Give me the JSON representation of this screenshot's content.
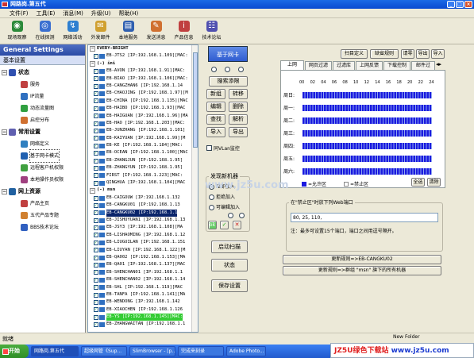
{
  "window": {
    "title": "网路岗.第五代",
    "min": "_",
    "max": "□",
    "close": "×"
  },
  "menu": [
    "文件(F)",
    "工具(E)",
    "消息(M)",
    "升级(U)",
    "帮助(H)"
  ],
  "toolbar": [
    {
      "label": "现场观察",
      "color": "#2c8a3a",
      "icon": "eye-icon",
      "glyph": "◉"
    },
    {
      "label": "在线探测",
      "color": "#3a6fd0",
      "icon": "globe-icon",
      "glyph": "◎"
    },
    {
      "label": "网络活动",
      "color": "#2e7fd0",
      "icon": "network-icon",
      "glyph": "↯"
    },
    {
      "label": "外发邮件",
      "color": "#d0a030",
      "icon": "mail-icon",
      "glyph": "✉"
    },
    {
      "label": "本地服务",
      "color": "#3060b0",
      "icon": "server-icon",
      "glyph": "▤"
    },
    {
      "label": "发送消息",
      "color": "#d07030",
      "icon": "message-icon",
      "glyph": "✎"
    },
    {
      "label": "产品信息",
      "color": "#c04040",
      "icon": "info-icon",
      "glyph": "i"
    },
    {
      "label": "技术论坛",
      "color": "#5050b0",
      "icon": "forum-icon",
      "glyph": "☷"
    }
  ],
  "left": {
    "header": "General Settings",
    "subheader": "基本设置",
    "tree": [
      {
        "label": "状态",
        "level": 0,
        "color": "#3050b0",
        "icon": "status-icon"
      },
      {
        "label": "服务",
        "level": 1,
        "color": "#c04040",
        "icon": "service-icon"
      },
      {
        "label": "IP流量",
        "level": 1,
        "color": "#3070c0",
        "icon": "ip-traffic-icon"
      },
      {
        "label": "动态流量图",
        "level": 1,
        "color": "#30a040",
        "icon": "traffic-chart-icon"
      },
      {
        "label": "启控分布",
        "level": 1,
        "color": "#d07030",
        "icon": "distribution-icon"
      },
      {
        "label": "常用设置",
        "level": 0,
        "color": "#6060b0",
        "icon": "settings-icon"
      },
      {
        "label": "网络定义",
        "level": 1,
        "color": "#3080c0",
        "icon": "network-def-icon"
      },
      {
        "label": "基于网卡模式",
        "level": 1,
        "color": "#2060b0",
        "icon": "nic-mode-icon",
        "selected": true
      },
      {
        "label": "远程客户机权限",
        "level": 1,
        "color": "#40a040",
        "icon": "remote-icon"
      },
      {
        "label": "本地操作员权限",
        "level": 1,
        "color": "#a04080",
        "icon": "operator-icon"
      },
      {
        "label": "网上资源",
        "level": 0,
        "color": "#2060a0",
        "icon": "web-resources-icon"
      },
      {
        "label": "产品主页",
        "level": 1,
        "color": "#c04040",
        "icon": "home-icon"
      },
      {
        "label": "五代产品专题",
        "level": 1,
        "color": "#d08030",
        "icon": "topic-icon"
      },
      {
        "label": "BBS技术论坛",
        "level": 1,
        "color": "#3060c0",
        "icon": "bbs-icon"
      }
    ]
  },
  "machines": [
    {
      "kind": "grp",
      "text": "EVERY-BRIGHT"
    },
    {
      "text": "EB-JTS2 [IP:192.168.1.109][MAC:"
    },
    {
      "kind": "grp",
      "text": "(-) ini"
    },
    {
      "text": "EB-AVON [IP:192.168.1.91][MAC:"
    },
    {
      "text": "EB-BIAO [IP:192.168.1.106][MAC:"
    },
    {
      "text": "EB-CANGZHAN6 [IP:192.168.1.14"
    },
    {
      "text": "EB-CHAOJING [IP:192.168.1.97][M"
    },
    {
      "text": "EB-CHINA [IP:192.168.1.135][MAC"
    },
    {
      "text": "EB-HAIBO [IP:192.168.1.93][MAC"
    },
    {
      "text": "EB-HAIGUAN [IP:192.168.1.96][MA"
    },
    {
      "text": "EB-HAO [IP:192.168.1.203][MAC:"
    },
    {
      "text": "EB-JUNZHANG [IP:192.168.1.101]"
    },
    {
      "text": "EB-KAIYUAN [IP:192.168.1.99][M"
    },
    {
      "text": "EB-KE [IP:192.168.1.184][MAC:"
    },
    {
      "text": "EB-OCEAN [IP:192.168.1.100][MAC"
    },
    {
      "text": "EB-ZHANGJUN [IP:192.168.1.95]"
    },
    {
      "text": "EB-ZHANGYUN [IP:192.168.1.95]"
    },
    {
      "text": "FIRST [IP:192.168.1.223][MAC:"
    },
    {
      "text": "QINGHUA [IP:192.168.1.104][MAC"
    },
    {
      "kind": "grp",
      "text": "(-) msn"
    },
    {
      "text": "EB-CAIGOUW [IP:192.168.1.132"
    },
    {
      "text": "EB-CANGKU01 [IP:192.168.1.13"
    },
    {
      "text": "EB-CANGKU02 [IP:192.168.1.1",
      "kind": "hl"
    },
    {
      "text": "EB-JISHUYUAN1 [IP:192.168.1.13"
    },
    {
      "text": "EB-JSY3 [IP:192.168.1.108][MA"
    },
    {
      "text": "EB-LISHAOMING [IP:192.168.1.12"
    },
    {
      "text": "EB-LIUGUILAN [IP:192.168.1.151"
    },
    {
      "text": "EB-LIUYAN [IP:192.168.1.122][M"
    },
    {
      "text": "EB-QA002 [IP:192.168.1.153][MA"
    },
    {
      "text": "EB-QA01 [IP:192.168.1.137][MAC"
    },
    {
      "text": "EB-SHENCHAN01 [IP:192.168.1.1"
    },
    {
      "text": "EB-SHENCHAN02 [IP:192.168.1.14"
    },
    {
      "text": "EB-SHL [IP:192.168.1.119][MAC"
    },
    {
      "text": "EB-TANFA [IP:192.168.1.141][MA"
    },
    {
      "text": "EB-WENDONG [IP:192.168.1.142"
    },
    {
      "text": "EB-XIAOCHEN [IP:192.168.1.126"
    },
    {
      "text": "EB-YS [IP:192.168.1.145][MAC:",
      "kind": "green"
    },
    {
      "text": "EB-ZHANGWAITAN [IP:192.168.1.1"
    }
  ],
  "mid": {
    "nic_button": "基于网卡",
    "buttons": [
      "搜索添限",
      "新组",
      "转移",
      "编辑",
      "删除",
      "查找",
      "解析",
      "导入",
      "导出"
    ],
    "hint_checkbox": "同VLan监控",
    "discover_group": "发现新机器",
    "discover_options": [
      "立即加入",
      "拒绝加入",
      "可编辑加入"
    ],
    "scan_button": "启动扫描",
    "status_button": "状态",
    "save_button": "保存设置",
    "ok_glyph": "✓",
    "cancel_glyph": "✕"
  },
  "right": {
    "top_buttons": [
      "扫目定义",
      "缺省规则",
      "请零",
      "导出",
      "导入"
    ],
    "tabs": [
      "上网",
      "网页过滤",
      "过滤库",
      "上网反馈",
      "下载控制",
      "邮件过"
    ],
    "hours": [
      "00",
      "02",
      "04",
      "06",
      "08",
      "10",
      "12",
      "14",
      "16",
      "18",
      "20",
      "22",
      "24"
    ],
    "days": [
      "周日:",
      "周一:",
      "周二:",
      "周三:",
      "周四:",
      "周五:",
      "周六:"
    ],
    "legend_allow": "=允许区",
    "legend_deny": "=禁止区",
    "select_all": "全选",
    "clear": "清除",
    "port_title": "在\"禁止区\"时放下列Web端口",
    "ports_value": "80, 25, 110,",
    "note": "注：最多可设置15个端口，端口之间用逗号隔开。",
    "update_btn": "更新规则=>EB-CANGKU02",
    "update_group_btn": "更新规则=>群组 \"msn\" 旗下的所有机器"
  },
  "status": "就绪",
  "taskbar": {
    "start": "开始",
    "items": [
      "网路岗.第五代",
      "超级网管《Sup...",
      "SlimBrowser - [p...",
      "完成来刻录",
      "Adobe Photo..."
    ],
    "clock": "New Folder"
  },
  "watermark": {
    "mid": "www.jz5u.com",
    "site_a": "JZ5U绿色下载站",
    "site_b": "www.jz5u.com"
  }
}
